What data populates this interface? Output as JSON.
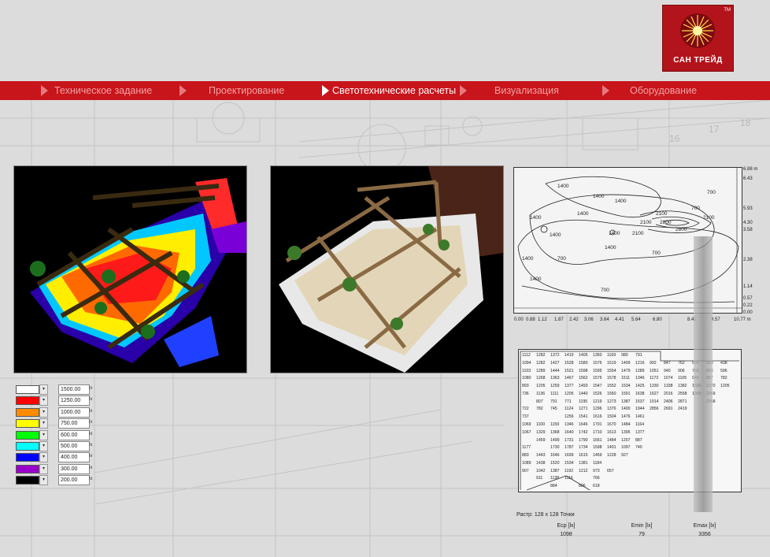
{
  "logo": {
    "text": "САН ТРЕЙД",
    "tm": "TM"
  },
  "nav": {
    "items": [
      {
        "label": "Техническое задание",
        "active": false
      },
      {
        "label": "Проектирование",
        "active": false
      },
      {
        "label": "Светотехнические расчеты",
        "active": true
      },
      {
        "label": "Визуализация",
        "active": false
      },
      {
        "label": "Оборудование",
        "active": false
      }
    ]
  },
  "legend": {
    "unit": "lx",
    "rows": [
      {
        "color": "#ffffff",
        "value": "1500.00"
      },
      {
        "color": "#ff0000",
        "value": "1250.00"
      },
      {
        "color": "#ff8c00",
        "value": "1000.00"
      },
      {
        "color": "#ffff00",
        "value": "750.00"
      },
      {
        "color": "#00ff00",
        "value": "600.00"
      },
      {
        "color": "#00ffff",
        "value": "500.00"
      },
      {
        "color": "#0000ff",
        "value": "400.00"
      },
      {
        "color": "#9900cc",
        "value": "300.00"
      },
      {
        "color": "#000000",
        "value": "200.00"
      }
    ]
  },
  "contour": {
    "labels": [
      "1400",
      "1400",
      "1400",
      "1400",
      "1400",
      "1400",
      "1400",
      "1400",
      "1400",
      "700",
      "700",
      "700",
      "2100",
      "2100",
      "2100",
      "2100",
      "2800",
      "2800",
      "1400",
      "700",
      "700"
    ],
    "x_ticks": [
      "0.00",
      "0.88",
      "1.12",
      "1.87",
      "2.42",
      "3.06",
      "3.64",
      "4.41",
      "5.64",
      "6.80",
      "8.42",
      "9.57",
      "10.77 m"
    ],
    "y_ticks": [
      "6.88 m",
      "6.43",
      "5.93",
      "4.30",
      "3.58",
      "2.38",
      "1.14",
      "0.57",
      "0.22",
      "0.00"
    ]
  },
  "grid_values": [
    [
      "1112",
      "1282",
      "1372",
      "1419",
      "1405",
      "1360",
      "1169",
      "980",
      "791"
    ],
    [
      "1094",
      "1282",
      "1427",
      "1528",
      "1580",
      "1576",
      "1519",
      "1409",
      "1216",
      "992",
      "847",
      "762",
      "593",
      "583",
      "438"
    ],
    [
      "1103",
      "1289",
      "1444",
      "1521",
      "1598",
      "1595",
      "1554",
      "1479",
      "1289",
      "1051",
      "940",
      "906",
      "756",
      "893",
      "596"
    ],
    [
      "1080",
      "1268",
      "1363",
      "1467",
      "1562",
      "1575",
      "1578",
      "1511",
      "1346",
      "1173",
      "1074",
      "1105",
      "946",
      "887",
      "782"
    ],
    [
      "893",
      "1205",
      "1259",
      "1377",
      "1493",
      "1547",
      "1552",
      "1534",
      "1425",
      "1330",
      "1338",
      "1382",
      "1585",
      "1370",
      "1205"
    ],
    [
      "736",
      "1136",
      "1111",
      "1205",
      "1440",
      "1526",
      "1560",
      "1591",
      "1638",
      "1627",
      "2016",
      "2558",
      "1365",
      "2069"
    ],
    [
      "",
      "807",
      "791",
      "771",
      "1195",
      "1219",
      "1273",
      "1387",
      "1537",
      "1914",
      "2406",
      "2871",
      "",
      "2958"
    ],
    [
      "722",
      "782",
      "745",
      "1124",
      "1271",
      "1296",
      "1376",
      "1400",
      "1944",
      "2856",
      "2691",
      "2419"
    ],
    [
      "737",
      "",
      "",
      "1256",
      "1541",
      "1616",
      "1504",
      "1476",
      "1461"
    ],
    [
      "1069",
      "1100",
      "1159",
      "1346",
      "1646",
      "1701",
      "1670",
      "1484",
      "1164"
    ],
    [
      "1067",
      "1329",
      "1368",
      "1640",
      "1742",
      "1710",
      "1613",
      "1395",
      "1377"
    ],
    [
      "",
      "1459",
      "1499",
      "1731",
      "1790",
      "1661",
      "1484",
      "1207",
      "887"
    ],
    [
      "1177",
      "",
      "1730",
      "1787",
      "1734",
      "1598",
      "1401",
      "1097",
      "740"
    ],
    [
      "883",
      "1443",
      "1646",
      "1699",
      "1615",
      "1469",
      "1228",
      "927"
    ],
    [
      "1089",
      "1438",
      "1520",
      "1534",
      "1381",
      "1184"
    ],
    [
      "907",
      "1042",
      "1387",
      "1192",
      "1212",
      "973",
      "657"
    ],
    [
      "",
      "911",
      "1138",
      "1116",
      "",
      "766"
    ],
    [
      "",
      "",
      "884",
      "",
      "806",
      "618"
    ]
  ],
  "raster": "Растр: 128 x 128 Точки",
  "stats": [
    {
      "label": "Eср [lx]",
      "value": "1098"
    },
    {
      "label": "Emin [lx]",
      "value": "79"
    },
    {
      "label": "Emax [lx]",
      "value": "3356"
    }
  ]
}
